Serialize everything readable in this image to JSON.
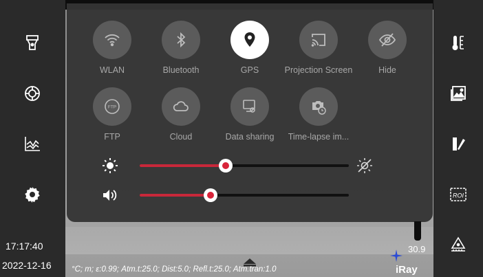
{
  "quick_settings": {
    "tiles": [
      {
        "label": "WLAN",
        "icon": "wifi-icon",
        "active": false
      },
      {
        "label": "Bluetooth",
        "icon": "bluetooth-icon",
        "active": false
      },
      {
        "label": "GPS",
        "icon": "location-pin-icon",
        "active": true
      },
      {
        "label": "Projection Screen",
        "icon": "cast-screen-icon",
        "active": false
      },
      {
        "label": "Hide",
        "icon": "eye-off-icon",
        "active": false
      },
      {
        "label": "FTP",
        "icon": "ftp-icon",
        "active": false
      },
      {
        "label": "Cloud",
        "icon": "cloud-icon",
        "active": false
      },
      {
        "label": "Data sharing",
        "icon": "data-sharing-icon",
        "active": false
      },
      {
        "label": "Time-lapse im...",
        "icon": "timelapse-camera-icon",
        "active": false
      }
    ],
    "brightness_level": 0.41,
    "volume_level": 0.34
  },
  "status": {
    "time": "17:17:40",
    "date": "2022-12-16",
    "params": "°C; m; ε:0.99; Atm.t:25.0; Dist:5.0; Refl.t:25.0; Atm.tran:1.0",
    "temperature": "30.9",
    "brand": "iRay"
  },
  "colors": {
    "accent": "#d8243a",
    "panel": "#343434",
    "tile_inactive": "#5b5b5b",
    "battery": "#5ad84a",
    "crosshair": "#2b4bd6"
  },
  "left_menu": [
    "flashlight-icon",
    "focus-icon",
    "chart-icon",
    "settings-icon"
  ],
  "right_menu": [
    "thermometer-icon",
    "gallery-icon",
    "palette-icon",
    "roi-icon",
    "measure-icon"
  ],
  "roi_label": "ROI"
}
